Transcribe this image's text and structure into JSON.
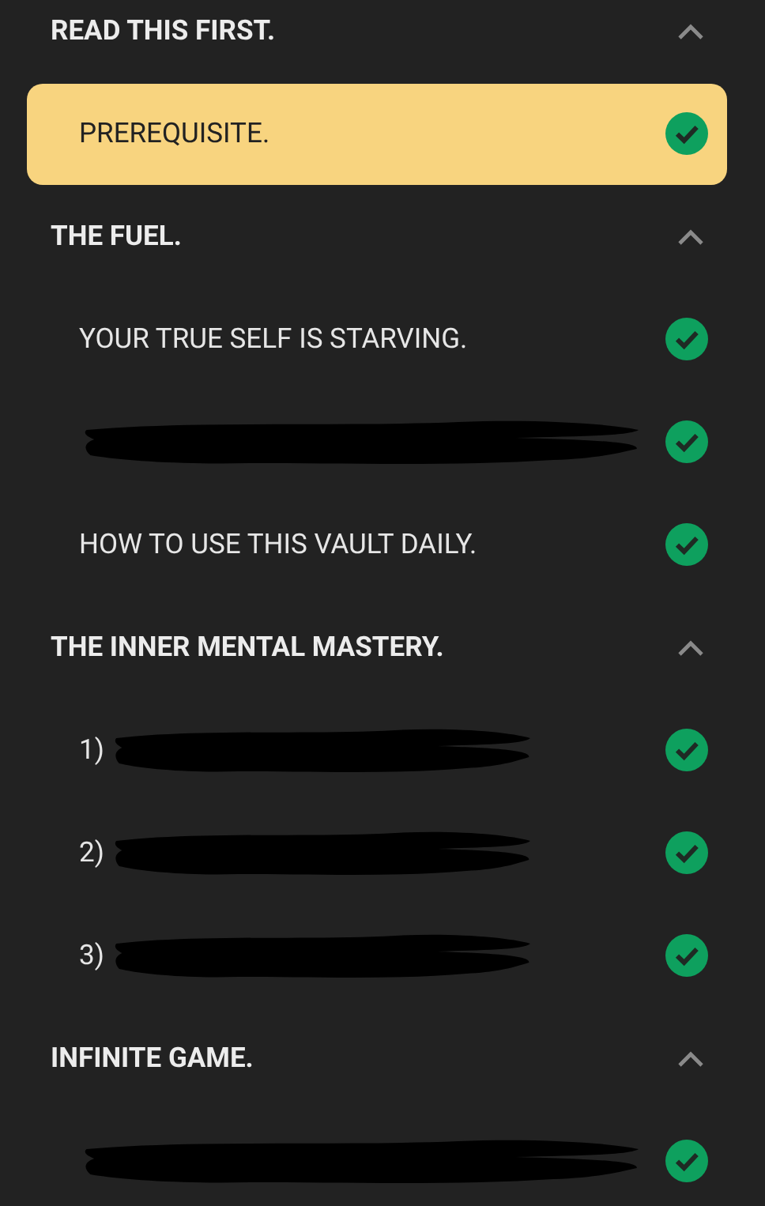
{
  "sections": [
    {
      "title": "READ THIS FIRST.",
      "expanded": true,
      "items": [
        {
          "label": "PREREQUISITE.",
          "redacted": false,
          "selected": true,
          "completed": true
        }
      ]
    },
    {
      "title": "THE FUEL.",
      "expanded": true,
      "items": [
        {
          "label": "YOUR TRUE SELF IS STARVING.",
          "redacted": false,
          "selected": false,
          "completed": true
        },
        {
          "redacted": true,
          "selected": false,
          "completed": true
        },
        {
          "label": "HOW TO USE THIS VAULT DAILY.",
          "redacted": false,
          "selected": false,
          "completed": true
        }
      ]
    },
    {
      "title": "THE INNER MENTAL MASTERY.",
      "expanded": true,
      "items": [
        {
          "label": "1)",
          "redacted": true,
          "selected": false,
          "completed": true
        },
        {
          "label": "2)",
          "redacted": true,
          "selected": false,
          "completed": true
        },
        {
          "label": "3)",
          "redacted": true,
          "selected": false,
          "completed": true
        }
      ]
    },
    {
      "title": "INFINITE GAME.",
      "expanded": true,
      "items": [
        {
          "redacted": true,
          "selected": false,
          "completed": true
        }
      ]
    }
  ]
}
